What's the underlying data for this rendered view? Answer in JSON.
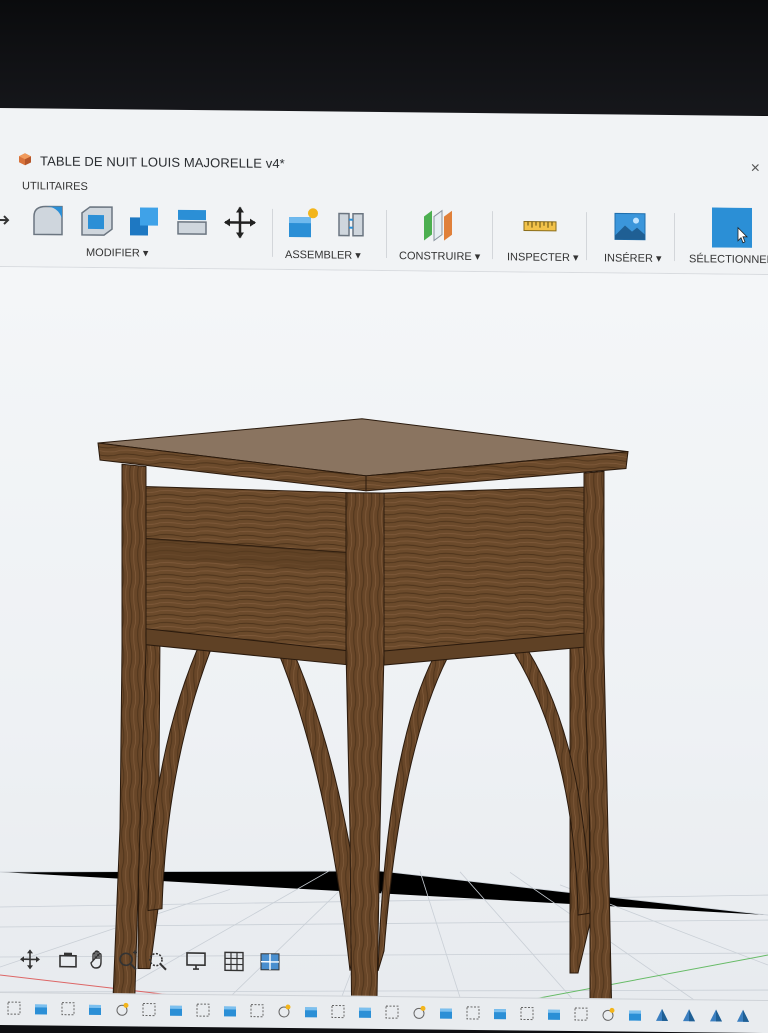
{
  "window": {
    "title": "TABLE DE NUIT LOUIS MAJORELLE v4*",
    "close_label": "×",
    "app_icon": "box-icon"
  },
  "menu": {
    "utilities_label": "UTILITAIRES"
  },
  "ribbon": {
    "groups": [
      {
        "label": "MODIFIER ▾",
        "tools": [
          "press-pull-icon",
          "fillet-icon",
          "shell-icon",
          "combine-icon",
          "replace-face-icon",
          "move-icon"
        ]
      },
      {
        "label": "ASSEMBLER ▾",
        "tools": [
          "new-component-icon",
          "joint-icon"
        ]
      },
      {
        "label": "CONSTRUIRE ▾",
        "tools": [
          "offset-plane-icon"
        ]
      },
      {
        "label": "INSPECTER ▾",
        "tools": [
          "measure-icon"
        ]
      },
      {
        "label": "INSÉRER ▾",
        "tools": [
          "insert-image-icon"
        ]
      },
      {
        "label": "SÉLECTIONNER",
        "tools": [
          "select-cursor-icon"
        ]
      }
    ],
    "accent_color": "#2b8fd6"
  },
  "viewport": {
    "model": "nightstand-3d-model",
    "wood_color": "#6b4a2b",
    "top_color": "#8a7460"
  },
  "nav_bar": {
    "tools": [
      "orbit-icon",
      "look-at-icon",
      "pan-icon",
      "zoom-icon",
      "zoom-window-icon",
      "display-settings-icon",
      "grid-icon",
      "viewports-icon"
    ]
  },
  "timeline": {
    "item_count": 28
  }
}
